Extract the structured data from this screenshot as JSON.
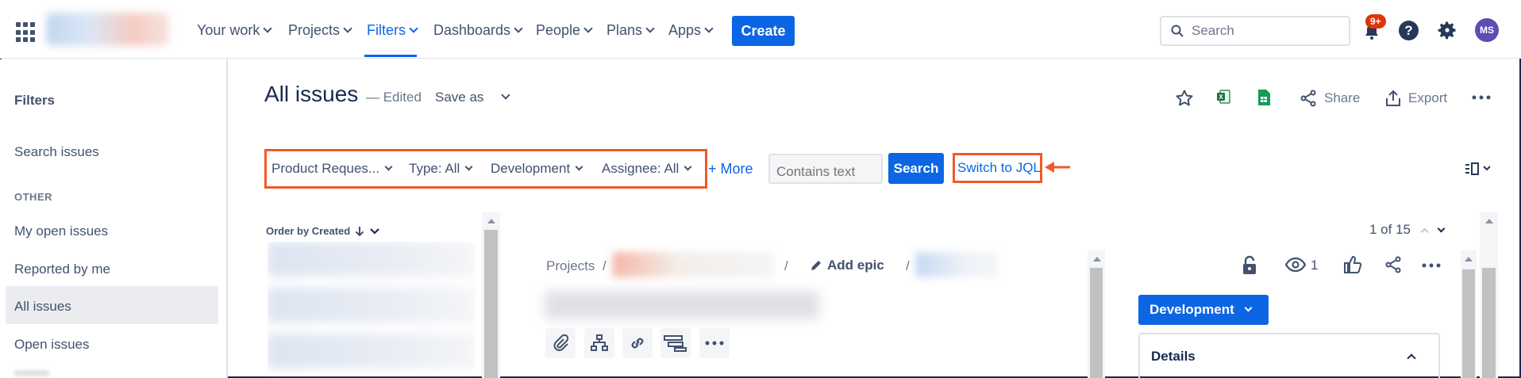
{
  "topnav": {
    "items": [
      {
        "label": "Your work"
      },
      {
        "label": "Projects"
      },
      {
        "label": "Filters"
      },
      {
        "label": "Dashboards"
      },
      {
        "label": "People"
      },
      {
        "label": "Plans"
      },
      {
        "label": "Apps"
      }
    ],
    "active_item": "Filters",
    "create_label": "Create",
    "search_placeholder": "Search",
    "notification_badge": "9+",
    "help_glyph": "?",
    "avatar_initials": "MS",
    "accent_color": "#0c66e4"
  },
  "sidebar": {
    "title": "Filters",
    "search_link": "Search issues",
    "section_label": "OTHER",
    "items": [
      {
        "label": "My open issues"
      },
      {
        "label": "Reported by me"
      },
      {
        "label": "All issues",
        "selected": true
      },
      {
        "label": "Open issues"
      }
    ]
  },
  "header": {
    "title": "All issues",
    "edited_label": "— Edited",
    "save_as_label": "Save as",
    "share_label": "Share",
    "export_label": "Export",
    "icons": [
      "star-icon",
      "excel-icon",
      "google-sheets-icon",
      "share-icon",
      "export-icon",
      "more-icon"
    ]
  },
  "filters": {
    "chips": [
      {
        "label": "Product Reques..."
      },
      {
        "label": "Type: All"
      },
      {
        "label": "Development"
      },
      {
        "label": "Assignee: All"
      }
    ],
    "more_label": "+ More",
    "contains_placeholder": "Contains text",
    "search_button": "Search",
    "switch_jql_label": "Switch to JQL",
    "highlight_color": "#f05a28"
  },
  "list": {
    "order_by_label": "Order by Created"
  },
  "detail": {
    "pager_text": "1 of 15",
    "breadcrumb_projects": "Projects",
    "breadcrumb_sep": "/",
    "add_epic_label": "Add epic",
    "watch_count": "1",
    "status_label": "Development",
    "details_label": "Details"
  }
}
